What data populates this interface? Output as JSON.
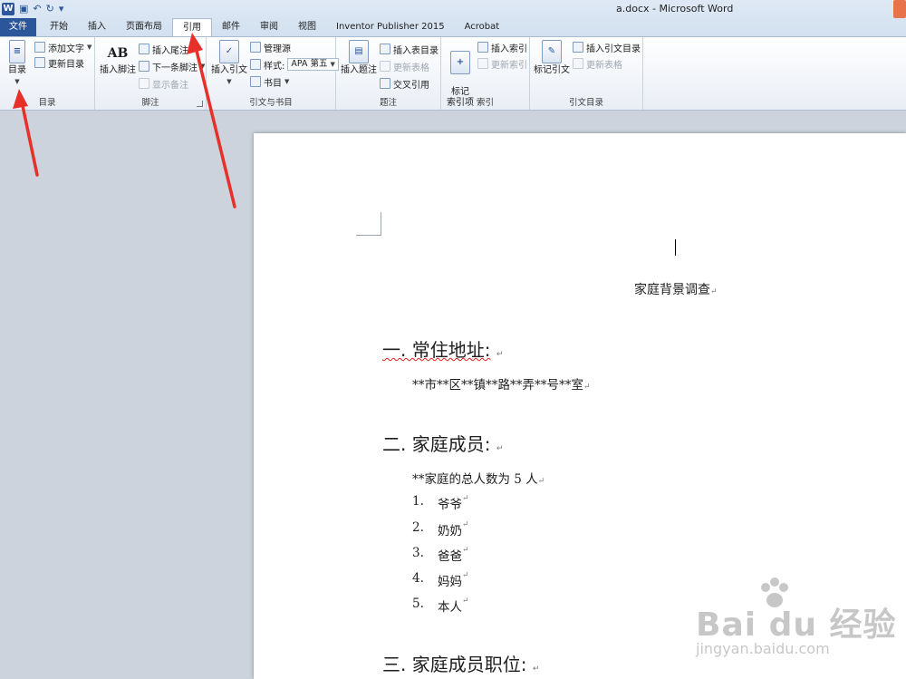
{
  "window": {
    "title": "a.docx - Microsoft Word",
    "tabs": [
      "文件",
      "开始",
      "插入",
      "页面布局",
      "引用",
      "邮件",
      "审阅",
      "视图",
      "Inventor Publisher 2015",
      "Acrobat"
    ],
    "active_tab": "引用"
  },
  "ribbon": {
    "toc": {
      "toc_label": "目录",
      "add_text": "添加文字",
      "update_toc": "更新目录",
      "group": "目录"
    },
    "footnotes": {
      "insert_footnote": "插入脚注",
      "insert_endnote": "插入尾注",
      "next_footnote": "下一条脚注",
      "show_notes": "显示备注",
      "group": "脚注",
      "ab_glyph": "AB"
    },
    "citations": {
      "insert_citation": "插入引文",
      "manage_sources": "管理源",
      "style_label": "样式:",
      "style_value": "APA 第五",
      "bibliography": "书目",
      "group": "引文与书目"
    },
    "captions": {
      "insert_caption": "插入题注",
      "insert_table_of_figures": "插入表目录",
      "update_table": "更新表格",
      "cross_reference": "交叉引用",
      "group": "题注"
    },
    "index": {
      "mark_entry": "标记\n索引项",
      "insert_index": "插入索引",
      "update_index": "更新索引",
      "group": "索引"
    },
    "authorities": {
      "mark_citation": "标记引文",
      "insert_toa": "插入引文目录",
      "update_table": "更新表格",
      "group": "引文目录"
    }
  },
  "document": {
    "heading": "家庭背景调查",
    "sections": [
      {
        "title": "一. 常住地址:",
        "body": "**市**区**镇**路**弄**号**室"
      },
      {
        "title": "二. 家庭成员:",
        "body": "**家庭的总人数为 5 人"
      },
      {
        "title": "三. 家庭成员职位:"
      }
    ],
    "members": [
      {
        "num": "1.",
        "name": "爷爷"
      },
      {
        "num": "2.",
        "name": "奶奶"
      },
      {
        "num": "3.",
        "name": "爸爸"
      },
      {
        "num": "4.",
        "name": "妈妈"
      },
      {
        "num": "5.",
        "name": "本人"
      }
    ],
    "para_mark": "↵"
  },
  "watermark": {
    "brand": "Bai du 经验",
    "url": "jingyan.baidu.com"
  },
  "colors": {
    "accent": "#2b579a",
    "arrow": "#e8302a",
    "ribbon_border": "#a9bcd3",
    "workspace": "#ccd3dd"
  }
}
